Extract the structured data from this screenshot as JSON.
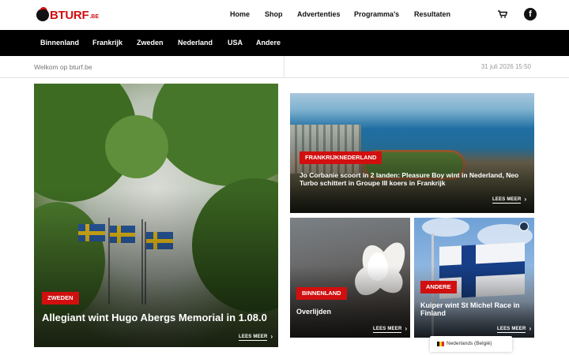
{
  "header": {
    "logo_text": "BTURF",
    "logo_suffix": ".BE",
    "nav": [
      "Home",
      "Shop",
      "Advertenties",
      "Programma’s",
      "Resultaten"
    ],
    "facebook_glyph": "f",
    "cart_icon": "cart-icon",
    "social_icon": "facebook-icon"
  },
  "categories": [
    "Binnenland",
    "Frankrijk",
    "Zweden",
    "Nederland",
    "USA",
    "Andere"
  ],
  "infobar": {
    "welcome": "Welkom op bturf.be",
    "datetime": "31 juli 2026 15:50"
  },
  "articles": {
    "main": {
      "badge": "ZWEDEN",
      "title": "Allegiant wint Hugo Abergs Memorial in 1.08.0",
      "more": "LEES MEER"
    },
    "top_right": {
      "badge": "FRANKRIJKNEDERLAND",
      "title": "Jo Corbanie scoort in 2 landen: Pleasure Boy wint in Nederland, Neo Turbo schittert in Groupe III koers in Frankrijk",
      "more": "LEES MEER"
    },
    "bottom_left": {
      "badge": "BINNENLAND",
      "title": "Overlijden",
      "more": "LEES MEER"
    },
    "bottom_right": {
      "badge": "ANDERE",
      "title": "Kuiper wint St Michel Race in Finland",
      "more": "LEES MEER"
    }
  },
  "language": {
    "label": "Nederlands (België)"
  },
  "colors": {
    "brand_red": "#d10f0f",
    "nav_bar": "#000000"
  }
}
